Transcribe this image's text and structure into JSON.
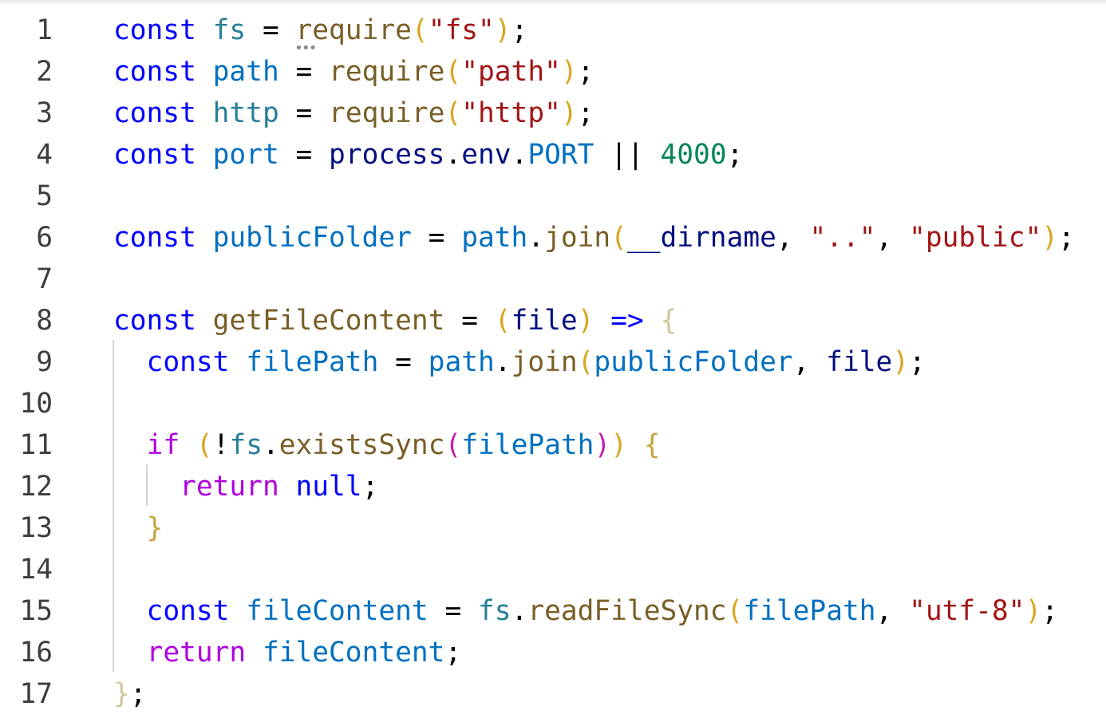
{
  "editor": {
    "lines": [
      {
        "n": "1",
        "tokens": [
          [
            "kw",
            "const"
          ],
          [
            "op",
            " "
          ],
          [
            "type",
            "fs"
          ],
          [
            "op",
            " = "
          ],
          [
            "fn",
            "require"
          ],
          [
            "b1",
            "("
          ],
          [
            "str",
            "\"fs\""
          ],
          [
            "b1",
            ")"
          ],
          [
            "op",
            ";"
          ]
        ]
      },
      {
        "n": "2",
        "tokens": [
          [
            "kw",
            "const"
          ],
          [
            "op",
            " "
          ],
          [
            "var",
            "path"
          ],
          [
            "op",
            " = "
          ],
          [
            "fn",
            "require"
          ],
          [
            "b1",
            "("
          ],
          [
            "str",
            "\"path\""
          ],
          [
            "b1",
            ")"
          ],
          [
            "op",
            ";"
          ]
        ]
      },
      {
        "n": "3",
        "tokens": [
          [
            "kw",
            "const"
          ],
          [
            "op",
            " "
          ],
          [
            "type",
            "http"
          ],
          [
            "op",
            " = "
          ],
          [
            "fn",
            "require"
          ],
          [
            "b1",
            "("
          ],
          [
            "str",
            "\"http\""
          ],
          [
            "b1",
            ")"
          ],
          [
            "op",
            ";"
          ]
        ]
      },
      {
        "n": "4",
        "tokens": [
          [
            "kw",
            "const"
          ],
          [
            "op",
            " "
          ],
          [
            "var",
            "port"
          ],
          [
            "op",
            " = "
          ],
          [
            "plain",
            "process"
          ],
          [
            "op",
            "."
          ],
          [
            "plain",
            "env"
          ],
          [
            "op",
            "."
          ],
          [
            "var",
            "PORT"
          ],
          [
            "op",
            " || "
          ],
          [
            "num",
            "4000"
          ],
          [
            "op",
            ";"
          ]
        ]
      },
      {
        "n": "5",
        "tokens": []
      },
      {
        "n": "6",
        "tokens": [
          [
            "kw",
            "const"
          ],
          [
            "op",
            " "
          ],
          [
            "var",
            "publicFolder"
          ],
          [
            "op",
            " = "
          ],
          [
            "var",
            "path"
          ],
          [
            "op",
            "."
          ],
          [
            "fn",
            "join"
          ],
          [
            "b1",
            "("
          ],
          [
            "plain",
            "__dirname"
          ],
          [
            "op",
            ", "
          ],
          [
            "str",
            "\"..\""
          ],
          [
            "op",
            ", "
          ],
          [
            "str",
            "\"public\""
          ],
          [
            "b1",
            ")"
          ],
          [
            "op",
            ";"
          ]
        ]
      },
      {
        "n": "7",
        "tokens": []
      },
      {
        "n": "8",
        "tokens": [
          [
            "kw",
            "const"
          ],
          [
            "op",
            " "
          ],
          [
            "fn",
            "getFileContent"
          ],
          [
            "op",
            " = "
          ],
          [
            "b1",
            "("
          ],
          [
            "plain",
            "file"
          ],
          [
            "b1",
            ")"
          ],
          [
            "op",
            " "
          ],
          [
            "kw",
            "=>"
          ],
          [
            "op",
            " "
          ],
          [
            "dim",
            "{"
          ]
        ]
      },
      {
        "n": "9",
        "tokens": [
          [
            "op",
            "  "
          ],
          [
            "kw",
            "const"
          ],
          [
            "op",
            " "
          ],
          [
            "var",
            "filePath"
          ],
          [
            "op",
            " = "
          ],
          [
            "var",
            "path"
          ],
          [
            "op",
            "."
          ],
          [
            "fn",
            "join"
          ],
          [
            "b1",
            "("
          ],
          [
            "var",
            "publicFolder"
          ],
          [
            "op",
            ", "
          ],
          [
            "plain",
            "file"
          ],
          [
            "b1",
            ")"
          ],
          [
            "op",
            ";"
          ]
        ]
      },
      {
        "n": "10",
        "tokens": []
      },
      {
        "n": "11",
        "tokens": [
          [
            "op",
            "  "
          ],
          [
            "ctl",
            "if"
          ],
          [
            "op",
            " "
          ],
          [
            "b1",
            "("
          ],
          [
            "op",
            "!"
          ],
          [
            "type",
            "fs"
          ],
          [
            "op",
            "."
          ],
          [
            "fn",
            "existsSync"
          ],
          [
            "b2",
            "("
          ],
          [
            "var",
            "filePath"
          ],
          [
            "b2",
            ")"
          ],
          [
            "b1",
            ")"
          ],
          [
            "op",
            " "
          ],
          [
            "b3",
            "{"
          ]
        ]
      },
      {
        "n": "12",
        "tokens": [
          [
            "op",
            "    "
          ],
          [
            "ctl",
            "return"
          ],
          [
            "op",
            " "
          ],
          [
            "kw",
            "null"
          ],
          [
            "op",
            ";"
          ]
        ]
      },
      {
        "n": "13",
        "tokens": [
          [
            "op",
            "  "
          ],
          [
            "b3",
            "}"
          ]
        ]
      },
      {
        "n": "14",
        "tokens": []
      },
      {
        "n": "15",
        "tokens": [
          [
            "op",
            "  "
          ],
          [
            "kw",
            "const"
          ],
          [
            "op",
            " "
          ],
          [
            "var",
            "fileContent"
          ],
          [
            "op",
            " = "
          ],
          [
            "type",
            "fs"
          ],
          [
            "op",
            "."
          ],
          [
            "fn",
            "readFileSync"
          ],
          [
            "b1",
            "("
          ],
          [
            "var",
            "filePath"
          ],
          [
            "op",
            ", "
          ],
          [
            "str",
            "\"utf-8\""
          ],
          [
            "b1",
            ")"
          ],
          [
            "op",
            ";"
          ]
        ]
      },
      {
        "n": "16",
        "tokens": [
          [
            "op",
            "  "
          ],
          [
            "ctl",
            "return"
          ],
          [
            "op",
            " "
          ],
          [
            "var",
            "fileContent"
          ],
          [
            "op",
            ";"
          ]
        ]
      },
      {
        "n": "17",
        "tokens": [
          [
            "dim",
            "}"
          ],
          [
            "op",
            ";"
          ]
        ]
      }
    ],
    "colors": {
      "keyword": "#0000ff",
      "control": "#af00db",
      "function": "#795e26",
      "variable": "#0070c1",
      "type": "#267f99",
      "string": "#a31515",
      "number": "#098658",
      "bracket_gold": "#d9a520",
      "bracket_pink": "#c51bb4",
      "line_number": "#3d3d3d",
      "background": "#ffffff"
    }
  }
}
